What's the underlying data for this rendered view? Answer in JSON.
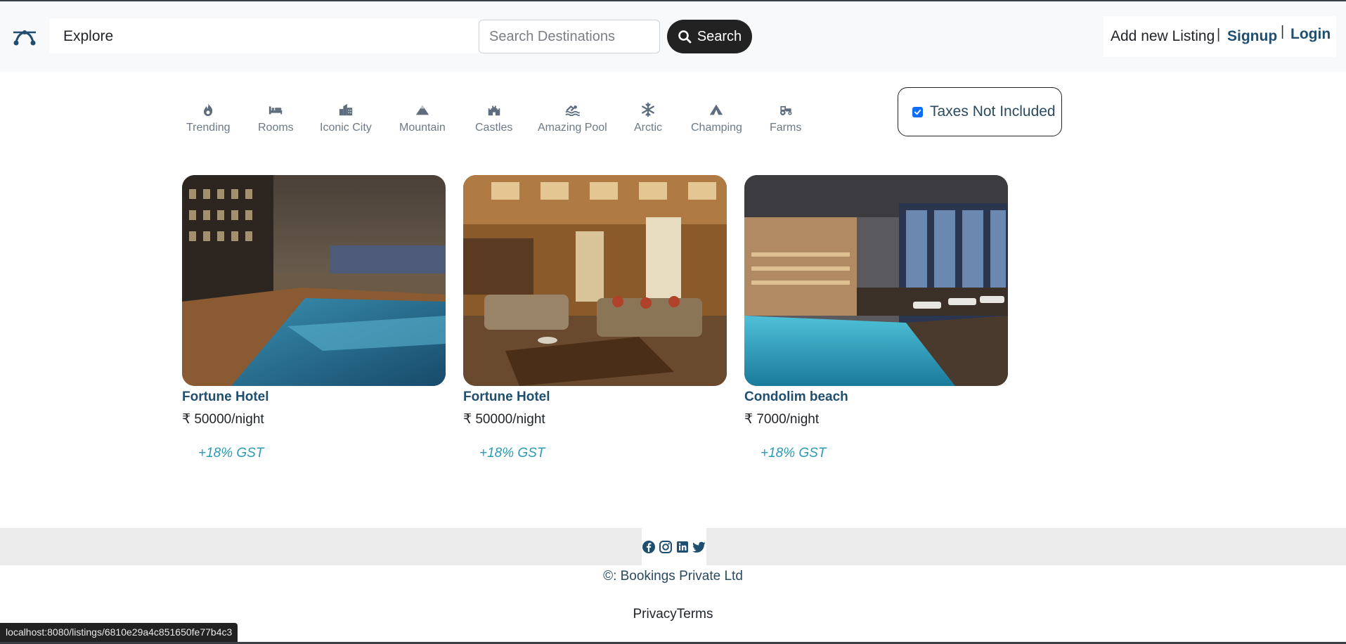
{
  "navbar": {
    "brand_icon": "compass-curve-icon",
    "explore_label": "Explore",
    "search_placeholder": "Search Destinations",
    "search_button_label": "Search",
    "add_listing_label": "Add new Listing",
    "separator": "|",
    "signup_label": "Signup",
    "login_label": "Login"
  },
  "filters": [
    {
      "label": "Trending",
      "icon": "fire-icon"
    },
    {
      "label": "Rooms",
      "icon": "bed-icon"
    },
    {
      "label": "Iconic City",
      "icon": "city-icon"
    },
    {
      "label": "Mountain",
      "icon": "mountain-icon"
    },
    {
      "label": "Castles",
      "icon": "castle-icon"
    },
    {
      "label": "Amazing Pool",
      "icon": "swimmer-icon"
    },
    {
      "label": "Arctic",
      "icon": "snowflake-icon"
    },
    {
      "label": "Champing",
      "icon": "tent-icon"
    },
    {
      "label": "Farms",
      "icon": "tractor-icon"
    }
  ],
  "tax_toggle": {
    "label": "Taxes Not Included",
    "checked": true
  },
  "listings": [
    {
      "title": "Fortune Hotel",
      "price": "₹ 50000/night",
      "gst": "+18% GST",
      "image": "hotel-indoor-pool"
    },
    {
      "title": "Fortune Hotel",
      "price": "₹ 50000/night",
      "gst": "+18% GST",
      "image": "hotel-lobby-lounge"
    },
    {
      "title": "Condolim beach",
      "price": "₹ 7000/night",
      "gst": "+18% GST",
      "image": "indoor-pool-sauna"
    }
  ],
  "footer": {
    "social_icons": [
      "facebook-icon",
      "instagram-icon",
      "linkedin-icon",
      "twitter-icon"
    ],
    "copyright": "©: Bookings Private Ltd",
    "links": "PrivacyTerms"
  },
  "status_bar_url": "localhost:8080/listings/6810e29a4c851650fe77b4c3",
  "colors": {
    "accent": "#1f4e6e",
    "gst": "#2a9bb5",
    "search_button": "#222222",
    "checkbox": "#0d6efd"
  }
}
